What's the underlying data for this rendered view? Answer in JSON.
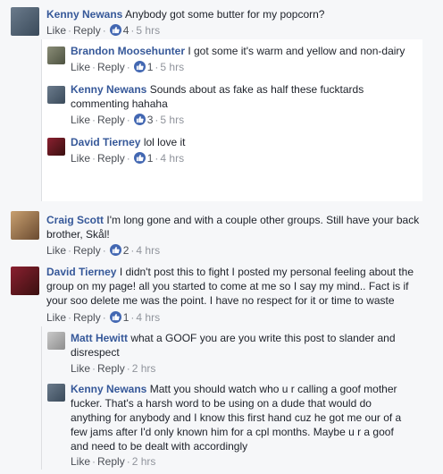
{
  "labels": {
    "like": "Like",
    "reply": "Reply"
  },
  "comments": [
    {
      "author": "Kenny Newans",
      "text": "Anybody got some butter for my popcorn?",
      "likes": "4",
      "time": "5 hrs",
      "replies": [
        {
          "author": "Brandon Moosehunter",
          "text": "I got some it's warm and yellow and non-dairy",
          "likes": "1",
          "time": "5 hrs"
        },
        {
          "author": "Kenny Newans",
          "text_line1": "Sounds about as fake as half these fucktards",
          "text_line2": "commenting hahaha",
          "likes": "3",
          "time": "5 hrs"
        },
        {
          "author": "David Tierney",
          "text": "lol love it",
          "likes": "1",
          "time": "4 hrs"
        }
      ]
    },
    {
      "author": "Craig Scott",
      "text_line1": "I'm long gone and with a couple other groups. Still have your back",
      "text_line2": "brother, Skål!",
      "likes": "2",
      "time": "4 hrs"
    },
    {
      "author": "David Tierney",
      "text_line1": "I didn't post this to fight I posted my personal feeling about the",
      "text_line2": "group on my page! all you started to come at me so I say my mind.. Fact is if",
      "text_line3": "your soo delete me was the point. I have no respect for it or time to waste",
      "likes": "1",
      "time": "4 hrs",
      "replies": [
        {
          "author": "Matt Hewitt",
          "text_line1": "what a GOOF you are you write this post to slander and",
          "text_line2": "disrespect",
          "time": "2 hrs"
        },
        {
          "author": "Kenny Newans",
          "text_line1": "Matt you should watch who u r calling a goof mother",
          "text_line2": "fucker. That's a harsh word to be using on a dude that would do",
          "text_line3": "anything for anybody and I know this first hand cuz he got me our of a",
          "text_line4": "few jams after I'd only known him for a cpl months. Maybe u r a goof",
          "text_line5": "and need to be dealt with accordingly",
          "time": "2 hrs"
        }
      ]
    }
  ],
  "colors": {
    "link": "#365899",
    "like_blue": "#4267b2",
    "muted": "#90949c",
    "background": "#f6f7f9"
  }
}
